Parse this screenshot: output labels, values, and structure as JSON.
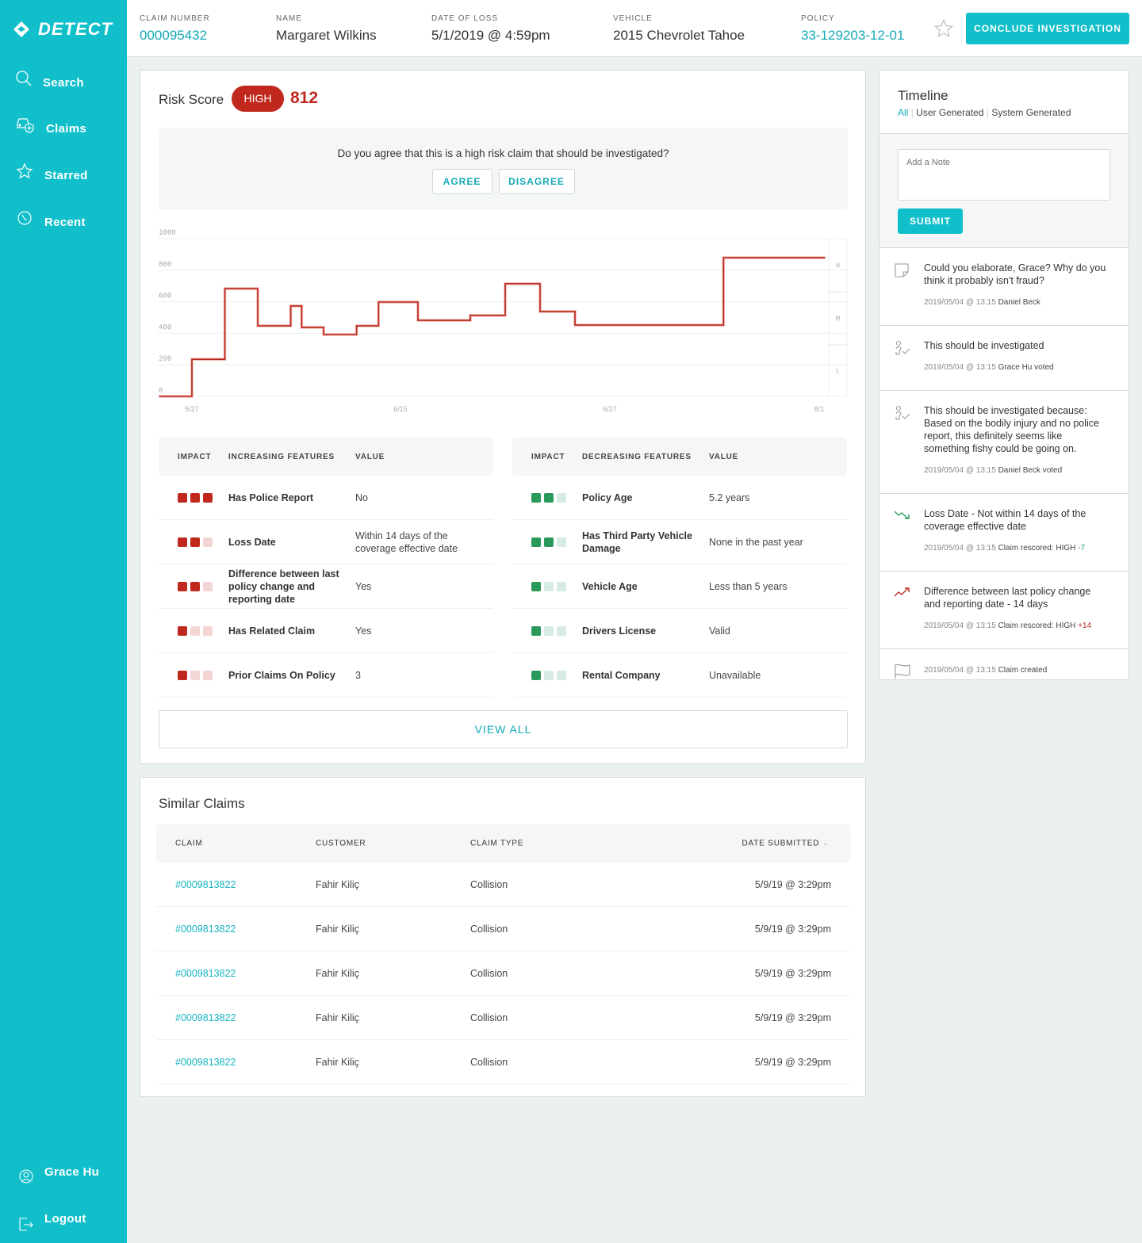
{
  "brand": {
    "name": "DETECT",
    "accent": "#10bfca",
    "high": "#c0281d",
    "low": "#2a9a5b"
  },
  "sidebar": {
    "items": [
      {
        "label": "Search",
        "icon": "search-icon"
      },
      {
        "label": "Claims",
        "icon": "car-shield-icon"
      },
      {
        "label": "Starred",
        "icon": "star-icon"
      },
      {
        "label": "Recent",
        "icon": "clock-icon"
      }
    ],
    "user": "Grace Hu",
    "logout": "Logout"
  },
  "header": {
    "claim_number": {
      "label": "CLAIM NUMBER",
      "value": "000095432"
    },
    "name": {
      "label": "NAME",
      "value": "Margaret Wilkins"
    },
    "date_of_loss": {
      "label": "DATE OF LOSS",
      "value": "5/1/2019 @ 4:59pm"
    },
    "vehicle": {
      "label": "VEHICLE",
      "value": "2015 Chevrolet Tahoe"
    },
    "policy": {
      "label": "POLICY",
      "value": "33-129203-12-01"
    },
    "conclude": "CONCLUDE INVESTIGATION"
  },
  "risk": {
    "title": "Risk Score",
    "level": "HIGH",
    "score": "812",
    "question": "Do you agree that this is a high risk claim that should be investigated?",
    "agree": "AGREE",
    "disagree": "DISAGREE",
    "view_all": "VIEW ALL"
  },
  "chart_data": {
    "type": "line",
    "step": true,
    "ylim": [
      0,
      1000
    ],
    "yticks": [
      "0",
      "200",
      "400",
      "600",
      "800",
      "1000"
    ],
    "xticks": [
      "5/27",
      "6/15",
      "6/27",
      "8/1"
    ],
    "bands": [
      "H",
      "M",
      "L"
    ],
    "grid": true,
    "points": [
      {
        "x": "5/24",
        "y": 0
      },
      {
        "x": "5/27",
        "y": 235
      },
      {
        "x": "5/30",
        "y": 683
      },
      {
        "x": "6/2",
        "y": 447
      },
      {
        "x": "6/5",
        "y": 573
      },
      {
        "x": "6/6",
        "y": 437
      },
      {
        "x": "6/8",
        "y": 392
      },
      {
        "x": "6/11",
        "y": 447
      },
      {
        "x": "6/13",
        "y": 598
      },
      {
        "x": "6/16",
        "y": 482
      },
      {
        "x": "6/19",
        "y": 513
      },
      {
        "x": "6/21",
        "y": 714
      },
      {
        "x": "6/23",
        "y": 538
      },
      {
        "x": "6/25",
        "y": 452
      },
      {
        "x": "7/16",
        "y": 879
      },
      {
        "x": "8/2",
        "y": 879
      }
    ]
  },
  "increasing": {
    "headers": [
      "IMPACT",
      "INCREASING FEATURES",
      "VALUE"
    ],
    "rows": [
      {
        "impact": 3,
        "feature": "Has Police Report",
        "value": "No"
      },
      {
        "impact": 2,
        "feature": "Loss Date",
        "value": "Within 14 days of the coverage effective date"
      },
      {
        "impact": 2,
        "feature": "Difference between last policy change and reporting date",
        "value": "Yes"
      },
      {
        "impact": 1,
        "feature": "Has Related Claim",
        "value": "Yes"
      },
      {
        "impact": 1,
        "feature": "Prior Claims On Policy",
        "value": "3"
      }
    ]
  },
  "decreasing": {
    "headers": [
      "IMPACT",
      "DECREASING FEATURES",
      "VALUE"
    ],
    "rows": [
      {
        "impact": 2,
        "feature": "Policy Age",
        "value": "5.2 years"
      },
      {
        "impact": 2,
        "feature": "Has Third Party Vehicle Damage",
        "value": "None in the past year"
      },
      {
        "impact": 1,
        "feature": "Vehicle Age",
        "value": "Less than 5 years"
      },
      {
        "impact": 1,
        "feature": "Drivers License",
        "value": "Valid"
      },
      {
        "impact": 1,
        "feature": "Rental Company",
        "value": "Unavailable"
      }
    ]
  },
  "similar": {
    "title": "Similar Claims",
    "headers": [
      "CLAIM",
      "CUSTOMER",
      "CLAIM TYPE",
      "DATE SUBMITTED"
    ],
    "rows": [
      {
        "claim": "#0009813822",
        "customer": "Fahir Kiliç",
        "type": "Collision",
        "date": "5/9/19 @ 3:29pm"
      },
      {
        "claim": "#0009813822",
        "customer": "Fahir Kiliç",
        "type": "Collision",
        "date": "5/9/19 @ 3:29pm"
      },
      {
        "claim": "#0009813822",
        "customer": "Fahir Kiliç",
        "type": "Collision",
        "date": "5/9/19 @ 3:29pm"
      },
      {
        "claim": "#0009813822",
        "customer": "Fahir Kiliç",
        "type": "Collision",
        "date": "5/9/19 @ 3:29pm"
      },
      {
        "claim": "#0009813822",
        "customer": "Fahir Kiliç",
        "type": "Collision",
        "date": "5/9/19 @ 3:29pm"
      }
    ]
  },
  "timeline": {
    "title": "Timeline",
    "filters": [
      "All",
      "User Generated",
      "System Generated"
    ],
    "note_placeholder": "Add a Note",
    "submit": "SUBMIT",
    "items": [
      {
        "icon": "note-icon",
        "text": "Could you elaborate, Grace? Why do you think it probably isn't fraud?",
        "time": "2019/05/04 @ 13:15",
        "who": "Daniel Beck",
        "delta": ""
      },
      {
        "icon": "user-vote-icon",
        "text": "This should be investigated",
        "time": "2019/05/04 @ 13:15",
        "who": "Grace Hu voted",
        "delta": ""
      },
      {
        "icon": "user-vote-icon",
        "text": "This should be investigated because: Based on the bodily injury and no police report, this definitely seems like something fishy could be going on.",
        "time": "2019/05/04 @ 13:15",
        "who": "Daniel Beck voted",
        "delta": ""
      },
      {
        "icon": "trend-down-icon",
        "text": "Loss Date - Not within 14 days of the coverage effective date",
        "time": "2019/05/04 @ 13:15",
        "who": "Claim rescored: HIGH",
        "delta": "-7"
      },
      {
        "icon": "trend-up-icon",
        "text": "Difference between last policy change and reporting date - 14 days",
        "time": "2019/05/04 @ 13:15",
        "who": "Claim rescored: HIGH",
        "delta": "+14"
      },
      {
        "icon": "flag-icon",
        "text": "",
        "time": "2019/05/04 @ 13:15",
        "who": "Claim created",
        "delta": ""
      }
    ]
  }
}
